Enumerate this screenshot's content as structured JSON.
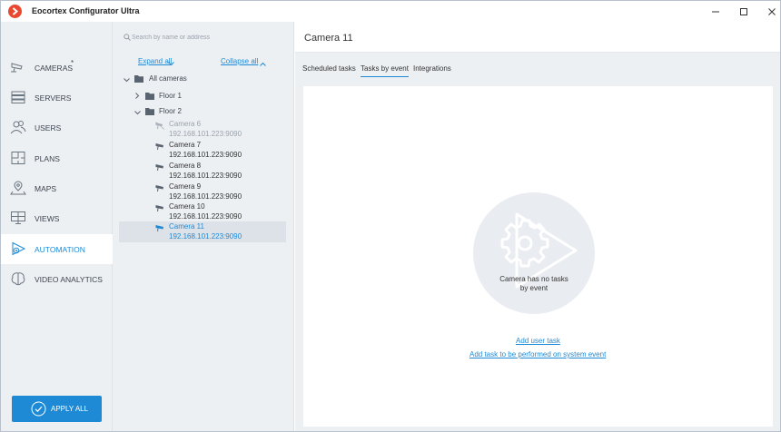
{
  "app": {
    "title": "Eocortex Configurator Ultra"
  },
  "nav": {
    "items": [
      {
        "label": "CAMERAS",
        "badge": "*"
      },
      {
        "label": "SERVERS"
      },
      {
        "label": "USERS"
      },
      {
        "label": "PLANS"
      },
      {
        "label": "MAPS"
      },
      {
        "label": "VIEWS"
      },
      {
        "label": "AUTOMATION"
      },
      {
        "label": "VIDEO ANALYTICS"
      }
    ],
    "apply_label": "APPLY ALL"
  },
  "tree": {
    "search_placeholder": "Search by name or address",
    "expand_label": "Expand all",
    "collapse_label": "Collapse all",
    "root_label": "All cameras",
    "folders": [
      "Floor 1",
      "Floor 2"
    ],
    "cameras": [
      {
        "name": "Camera 6",
        "address": "192.168.101.223:9090"
      },
      {
        "name": "Camera 7",
        "address": "192.168.101.223:9090"
      },
      {
        "name": "Camera 8",
        "address": "192.168.101.223:9090"
      },
      {
        "name": "Camera 9",
        "address": "192.168.101.223:9090"
      },
      {
        "name": "Camera 10",
        "address": "192.168.101.223:9090"
      },
      {
        "name": "Camera 11",
        "address": "192.168.101.223:9090"
      }
    ]
  },
  "main": {
    "title": "Camera 11",
    "tabs": [
      "Scheduled tasks",
      "Tasks by event",
      "Integrations"
    ],
    "empty_text": "Camera has no tasks by event",
    "links": [
      "Add user task",
      "Add task to be performed on system event"
    ]
  },
  "colors": {
    "accent": "#1e8ad6",
    "logo": "#e8482f",
    "panel_bg": "#edf0f3"
  }
}
